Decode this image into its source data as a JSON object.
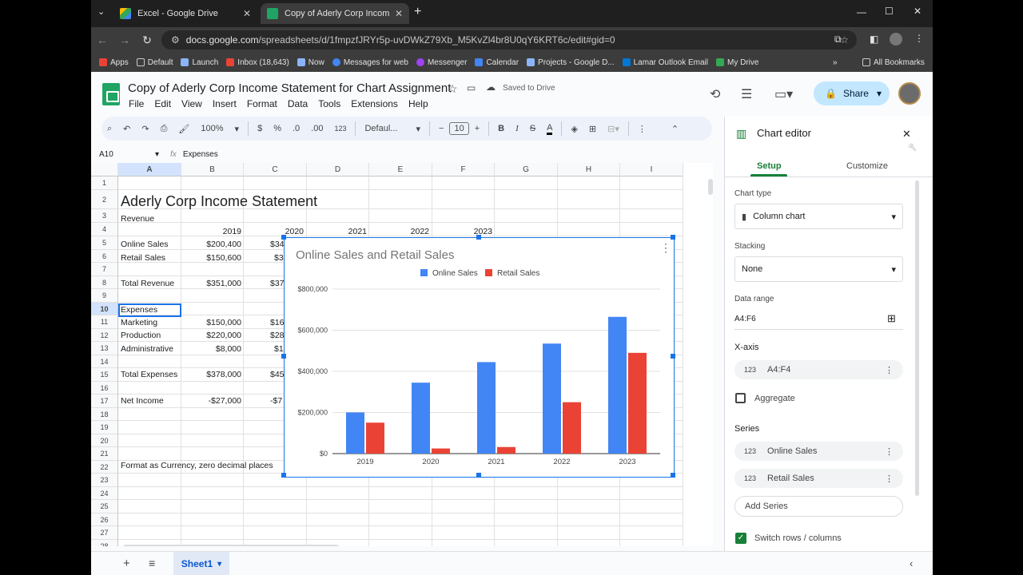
{
  "browser": {
    "tabs": [
      {
        "title": "Excel - Google Drive"
      },
      {
        "title": "Copy of Aderly Corp Income St"
      }
    ],
    "url_host": "docs.google.com",
    "url_path": "/spreadsheets/d/1fmpzfJRYr5p-uvDWkZ79Xb_M5KvZl4br8U0qY6KRT6c/edit#gid=0",
    "bookmarks": [
      "Apps",
      "Default",
      "Launch",
      "Inbox (18,643)",
      "Now",
      "Messages for web",
      "Messenger",
      "Calendar",
      "Projects - Google D...",
      "Lamar Outlook Email",
      "My Drive"
    ],
    "all_bookmarks": "All Bookmarks"
  },
  "doc": {
    "title": "Copy of Aderly Corp Income Statement for Chart Assignment",
    "saved": "Saved to Drive",
    "share": "Share",
    "menus": [
      "File",
      "Edit",
      "View",
      "Insert",
      "Format",
      "Data",
      "Tools",
      "Extensions",
      "Help"
    ]
  },
  "toolbar": {
    "zoom": "100%",
    "currency": "$",
    "percent": "%",
    "dec_less": ".0",
    "dec_more": ".00",
    "num": "123",
    "font": "Defaul...",
    "size": "10"
  },
  "formula": {
    "cell": "A10",
    "value": "Expenses"
  },
  "grid": {
    "columns": [
      "A",
      "B",
      "C",
      "D",
      "E",
      "F",
      "G",
      "H",
      "I"
    ],
    "rows": [
      "1",
      "2",
      "3",
      "4",
      "5",
      "6",
      "7",
      "8",
      "9",
      "10",
      "11",
      "12",
      "13",
      "14",
      "15",
      "16",
      "17",
      "18",
      "19",
      "20",
      "21",
      "22",
      "23",
      "24",
      "25",
      "26",
      "27",
      "28"
    ],
    "title": "Aderly Corp Income Statement",
    "revenue": "Revenue",
    "years": [
      "2019",
      "2020",
      "2021",
      "2022",
      "2023"
    ],
    "online": "Online Sales",
    "online_b": "$200,400",
    "online_c": "$34",
    "retail": "Retail Sales",
    "retail_b": "$150,600",
    "retail_c": "$3",
    "total_rev": "Total Revenue",
    "total_rev_b": "$351,000",
    "total_rev_c": "$37",
    "expenses": "Expenses",
    "marketing": "Marketing",
    "marketing_b": "$150,000",
    "marketing_c": "$16",
    "production": "Production",
    "production_b": "$220,000",
    "production_c": "$28",
    "admin": "Administrative",
    "admin_b": "$8,000",
    "admin_c": "$1",
    "total_exp": "Total Expenses",
    "total_exp_b": "$378,000",
    "total_exp_c": "$45",
    "net": "Net Income",
    "net_b": "-$27,000",
    "net_c": "-$7",
    "note": "Format as Currency, zero decimal places"
  },
  "chart_data": {
    "type": "bar",
    "title": "Online Sales and Retail Sales",
    "categories": [
      "2019",
      "2020",
      "2021",
      "2022",
      "2023"
    ],
    "series": [
      {
        "name": "Online Sales",
        "color": "#4285f4",
        "values": [
          200400,
          345000,
          445000,
          535000,
          665000
        ]
      },
      {
        "name": "Retail Sales",
        "color": "#ea4335",
        "values": [
          150600,
          25000,
          32000,
          250000,
          490000
        ]
      }
    ],
    "ylim": [
      0,
      800000
    ],
    "yticks": [
      "$0",
      "$200,000",
      "$400,000",
      "$600,000",
      "$800,000"
    ],
    "legend": "top",
    "grid": true
  },
  "editor": {
    "title": "Chart editor",
    "tab_setup": "Setup",
    "tab_custom": "Customize",
    "chart_type_label": "Chart type",
    "chart_type": "Column chart",
    "stacking_label": "Stacking",
    "stacking": "None",
    "range_label": "Data range",
    "range": "A4:F6",
    "xaxis_label": "X-axis",
    "xaxis": "A4:F4",
    "num_icon": "123",
    "aggregate": "Aggregate",
    "series_label": "Series",
    "series": [
      "Online Sales",
      "Retail Sales"
    ],
    "add_series": "Add Series",
    "switch": "Switch rows / columns"
  },
  "sheet": {
    "name": "Sheet1"
  }
}
